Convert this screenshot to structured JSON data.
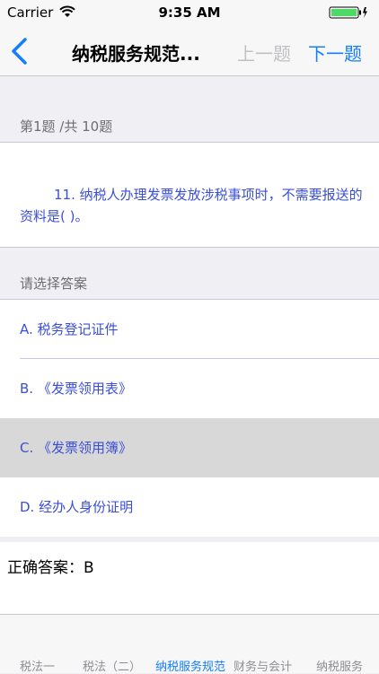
{
  "status_bar": {
    "carrier": "Carrier",
    "time": "9:35 AM"
  },
  "nav": {
    "title": "纳税服务规范...",
    "prev_label": "上一题",
    "next_label": "下一题"
  },
  "question": {
    "counter": "第1题 /共 10题",
    "text": "11. 纳税人办理发票发放涉税事项时，不需要报送的资料是(    )。"
  },
  "answers": {
    "prompt": "请选择答案",
    "options": [
      {
        "label": "A. 税务登记证件"
      },
      {
        "label": "B. 《发票领用表》"
      },
      {
        "label": "C. 《发票领用簿》",
        "selected": true
      },
      {
        "label": "D. 经办人身份证明"
      }
    ],
    "correct_answer": "正确答案：B"
  },
  "tabs": [
    {
      "label": "税法一"
    },
    {
      "label": "税法（二）"
    },
    {
      "label": "纳税服务规范",
      "active": true
    },
    {
      "label": "财务与会计"
    },
    {
      "label": "纳税服务"
    }
  ],
  "colors": {
    "accent": "#147efb",
    "option_text": "#3b4fd6",
    "selected_bg": "#d8d8d8"
  }
}
